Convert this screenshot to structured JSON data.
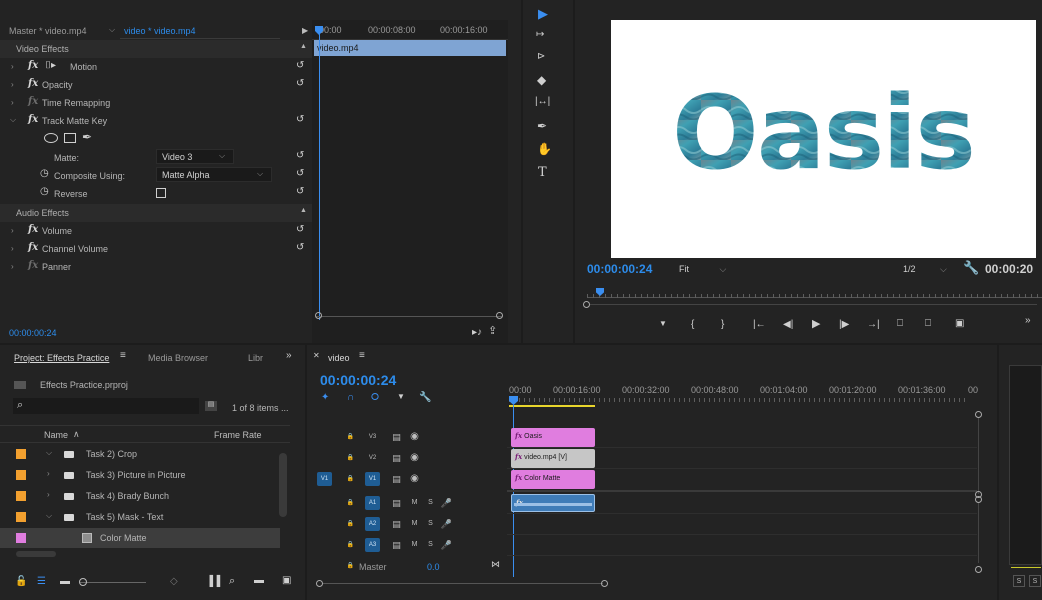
{
  "effect_controls": {
    "source_tab": "Master * video.mp4",
    "clip_tab": "video * video.mp4",
    "ruler": [
      "00:00",
      "00:00:08:00",
      "00:00:16:00"
    ],
    "clip_label": "video.mp4",
    "video_section": "Video Effects",
    "audio_section": "Audio Effects",
    "motion": "Motion",
    "opacity": "Opacity",
    "time_remapping": "Time Remapping",
    "track_matte_key": "Track Matte Key",
    "matte_label": "Matte:",
    "matte_value": "Video 3",
    "composite_label": "Composite Using:",
    "composite_value": "Matte Alpha",
    "reverse_label": "Reverse",
    "volume": "Volume",
    "channel_volume": "Channel Volume",
    "panner": "Panner",
    "timecode": "00:00:00:24",
    "fx_symbol": "fx"
  },
  "program_monitor": {
    "title_text": "Oasis",
    "timecode": "00:00:00:24",
    "fit_value": "Fit",
    "resolution_value": "1/2",
    "duration": "00:00:20"
  },
  "project": {
    "tabs": [
      "Project: Effects Practice",
      "Media Browser",
      "Libr"
    ],
    "file_name": "Effects Practice.prproj",
    "item_count": "1 of 8 items ...",
    "col_name": "Name",
    "col_frame_rate": "Frame Rate",
    "items": [
      {
        "label": "Task 2) Crop",
        "expanded": true,
        "color": "#f2a02f"
      },
      {
        "label": "Task 3) Picture in Picture",
        "expanded": false,
        "color": "#f2a02f"
      },
      {
        "label": "Task 4) Brady Bunch",
        "expanded": false,
        "color": "#f2a02f"
      },
      {
        "label": "Task 5) Mask - Text",
        "expanded": true,
        "color": "#f2a02f"
      },
      {
        "label": "Color Matte",
        "expanded": false,
        "color": "#e07ddf"
      }
    ]
  },
  "timeline": {
    "sequence_tab": "video",
    "timecode": "00:00:00:24",
    "ruler": [
      "00:00",
      "00:00:16:00",
      "00:00:32:00",
      "00:00:48:00",
      "00:01:04:00",
      "00:01:20:00",
      "00:01:36:00",
      "00"
    ],
    "tracks": {
      "v3": "V3",
      "v2": "V2",
      "v1": "V1",
      "src_v1": "V1",
      "a1": "A1",
      "a2": "A2",
      "a3": "A3",
      "master": "Master",
      "master_val": "0.0",
      "m": "M",
      "s": "S"
    },
    "clips": {
      "oasis": "Oasis",
      "video": "video.mp4 [V]",
      "matte": "Color Matte"
    }
  },
  "audio_meter": {
    "solo_labels": [
      "S",
      "S"
    ]
  },
  "colors": {
    "accent_blue": "#2d8ceb",
    "clip_pink": "#e07ddf",
    "clip_gray": "#c6c6c6",
    "clip_audio": "#3f7cb8",
    "folder_orange": "#f2a02f"
  }
}
